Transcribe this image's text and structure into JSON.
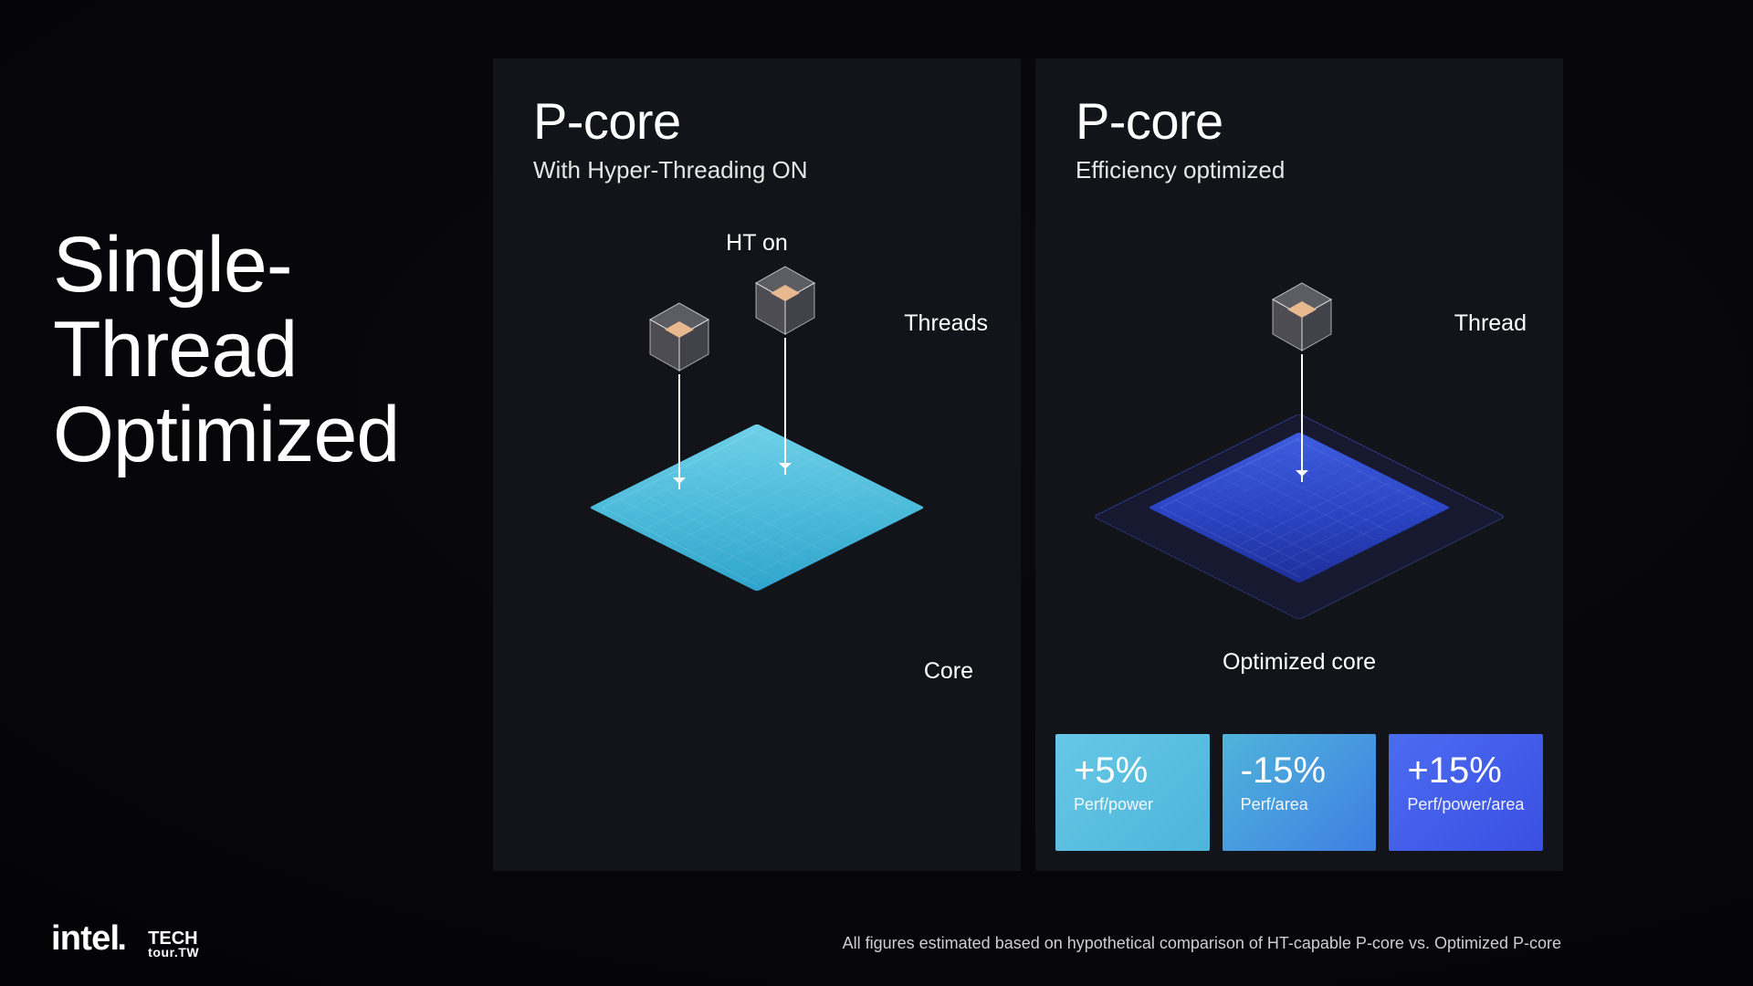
{
  "title_lines": [
    "Single-",
    "Thread",
    "Optimized"
  ],
  "panel_left": {
    "heading": "P-core",
    "sub": "With Hyper-Threading ON",
    "label_top": "HT on",
    "label_right": "Threads",
    "label_bottom": "Core"
  },
  "panel_right": {
    "heading": "P-core",
    "sub": "Efficiency optimized",
    "label_right": "Thread",
    "label_bottom": "Optimized core"
  },
  "metrics": [
    {
      "value": "+5%",
      "label": "Perf/power"
    },
    {
      "value": "-15%",
      "label": "Perf/area"
    },
    {
      "value": "+15%",
      "label": "Perf/power/area"
    }
  ],
  "disclaimer": "All figures estimated based on hypothetical comparison of HT-capable P-core vs. Optimized P-core",
  "brand": {
    "intel": "intel",
    "tech_top": "TECH",
    "tech_bottom": "tour.TW"
  }
}
